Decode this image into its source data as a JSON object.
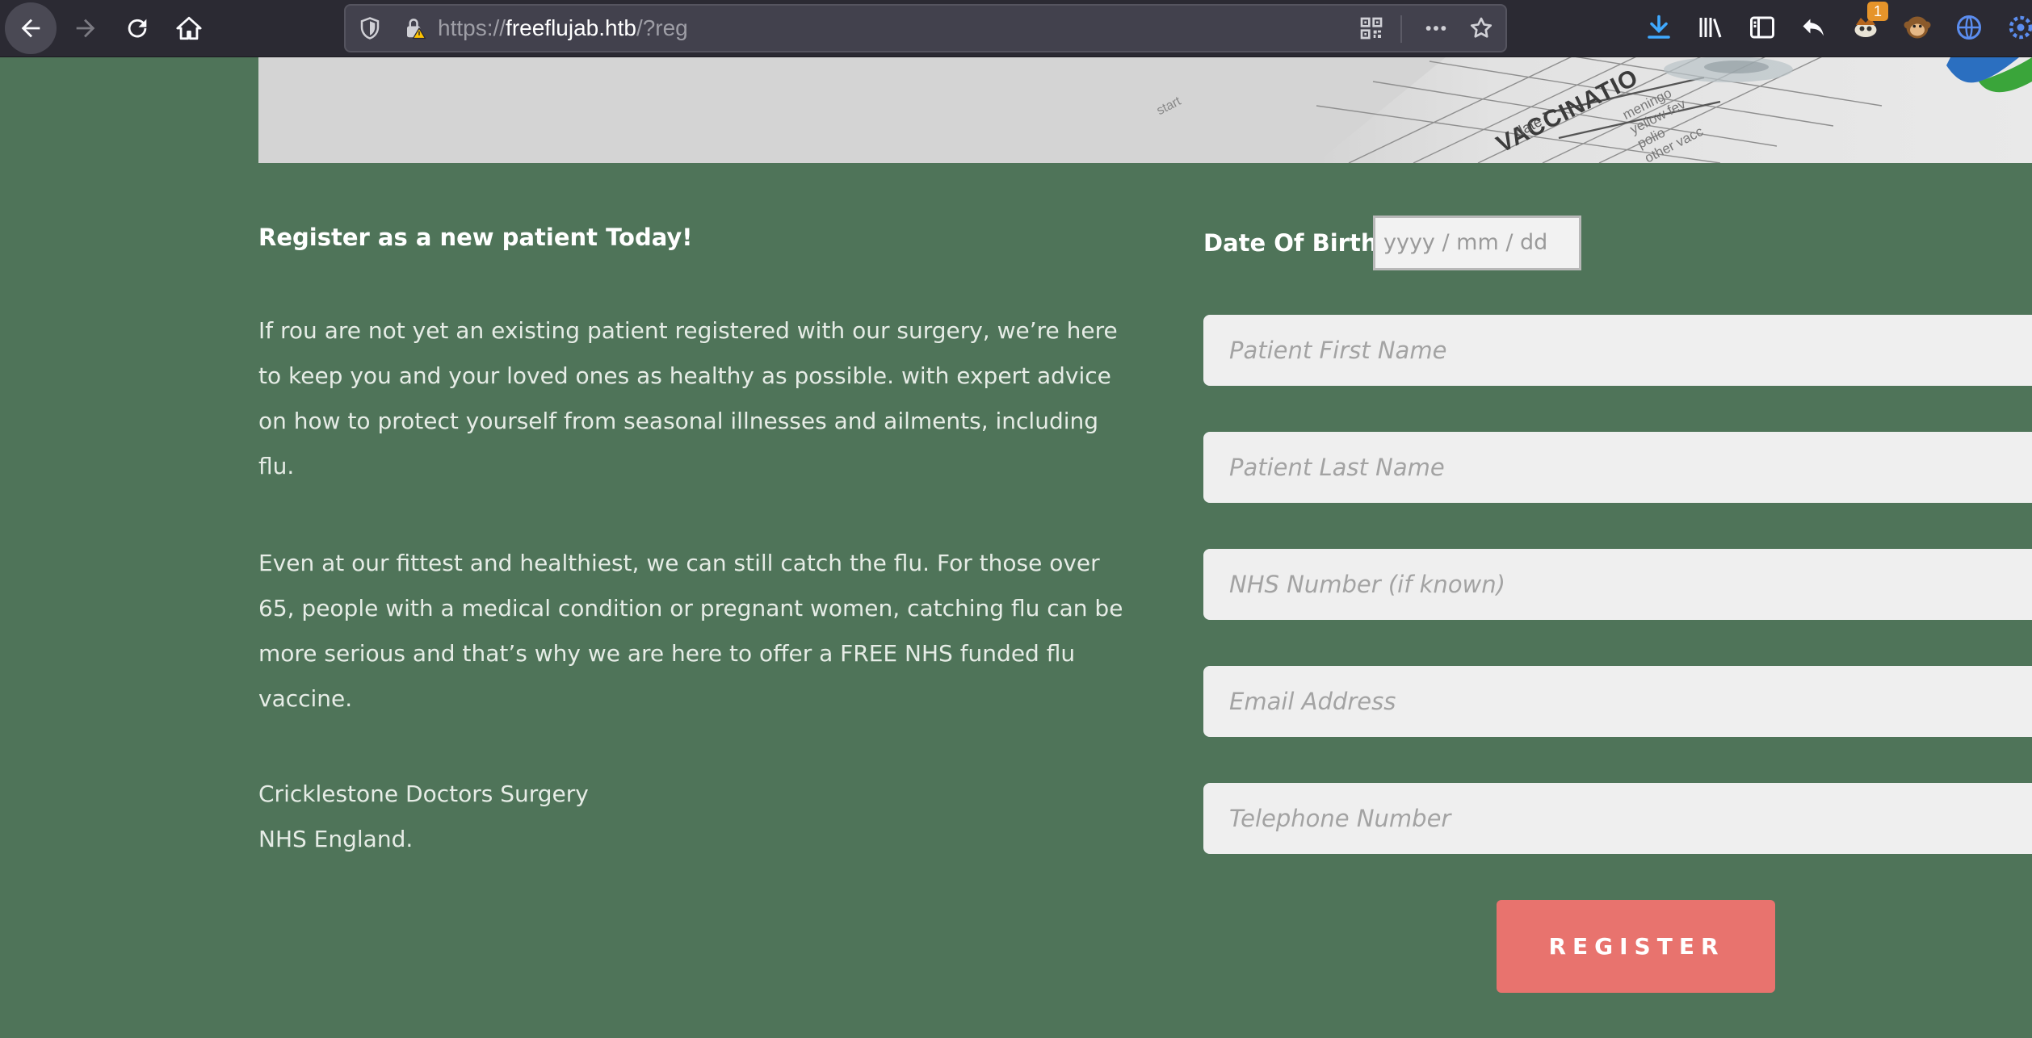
{
  "browser": {
    "url_scheme": "https://",
    "url_host": "freeflujab.htb",
    "url_path": "/?reg",
    "extension_badge": "1",
    "toolbar_icons": [
      "back-icon",
      "forward-icon",
      "reload-icon",
      "home-icon",
      "shield-icon",
      "lock-warning-icon",
      "qr-code-icon",
      "more-icon",
      "bookmark-star-icon",
      "download-icon",
      "library-icon",
      "sidebar-icon",
      "undo-icon",
      "extension-icon",
      "monkey-icon",
      "globe-icon",
      "settings-icon"
    ]
  },
  "hero": {
    "label_vaccination": "VACCINATIO",
    "label_date": "date",
    "label_side": "meningo\nyellow fev\npolio\nother vacc",
    "label_start": "start"
  },
  "intro": {
    "heading": "Register as a new patient Today!",
    "paragraph1": "If rou are not yet an existing patient registered with our surgery, we’re here to keep you and your loved ones as healthy as possible. with expert advice on how to protect yourself from seasonal illnesses and ailments, including flu.",
    "paragraph2": "Even at our fittest and healthiest, we can still catch the flu. For those over 65, people with a medical condition or pregnant women, catching flu can be more serious and that’s why we are here to offer a FREE NHS funded flu vaccine.",
    "signature_line1": "Cricklestone Doctors Surgery",
    "signature_line2": "NHS England."
  },
  "form": {
    "dob_label": "Date Of Birth:",
    "dob_placeholder": "yyyy / mm / dd",
    "first_name_placeholder": "Patient First Name",
    "last_name_placeholder": "Patient Last Name",
    "nhs_number_placeholder": "NHS Number (if known)",
    "email_placeholder": "Email Address",
    "telephone_placeholder": "Telephone Number",
    "register_label": "REGISTER"
  },
  "colors": {
    "page_background": "#4f7459",
    "button": "#e8736e",
    "field_background": "#efefef",
    "toolbar": "#2b2a33"
  }
}
